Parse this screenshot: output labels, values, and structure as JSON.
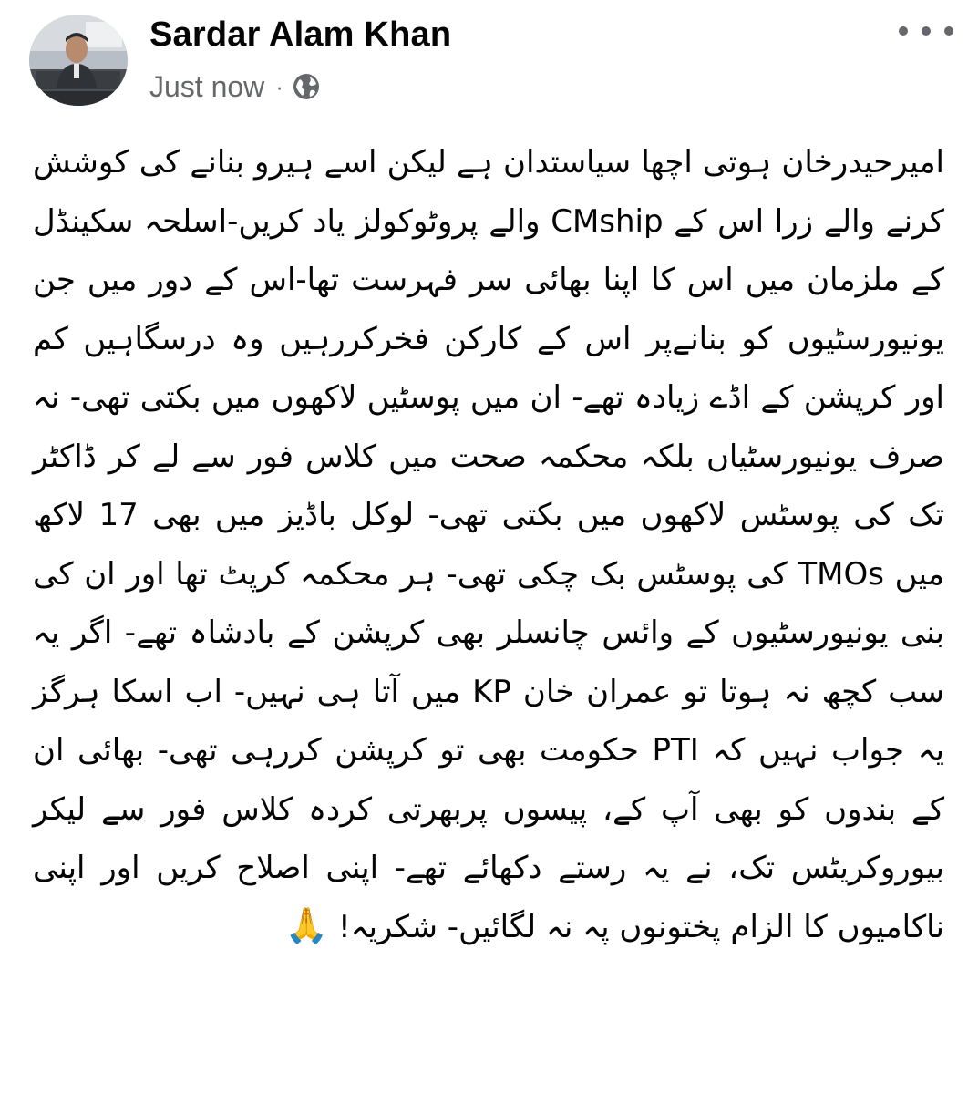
{
  "post": {
    "author": "Sardar Alam Khan",
    "timestamp": "Just now",
    "separator": "·",
    "privacy_icon": "globe-icon",
    "more_icon": "more-options-icon",
    "avatar_icon": "profile-avatar"
  },
  "content": {
    "text": "امیرحیدرخان ہوتی اچھا سیاستدان ہے لیکن اسے ہیرو بنانے کی کوشش کرنے والے زرا اس کے CMship والے پروٹوکولز یاد کریں-اسلحہ سکینڈل کے ملزمان میں اس کا اپنا بھائی سر فہرست تھا-اس کے دور میں جن یونیورسٹیوں کو بنانےپر اس کے کارکن فخرکررہیں وہ درسگاہیں کم اور کرپشن کے اڈے زیادہ تھے- ان میں پوسٹیں لاکھوں میں بکتی تھی- نہ صرف یونیورسٹیاں بلکہ محکمہ صحت میں کلاس فور سے لے کر ڈاکٹر تک کی پوسٹس لاکھوں میں بکتی تھی- لوکل باڈیز میں بھی 17 لاکھ میں TMOs کی پوسٹس بک چکی تھی- ہر محکمہ کرپٹ تھا اور ان کی بنی یونیورسٹیوں کے وائس چانسلر بھی کرپشن کے بادشاہ تھے- اگر یہ سب کچھ نہ ہوتا تو عمران خان KP میں آتا ہی نہیں- اب اسکا ہرگز یہ جواب نہیں کہ PTI حکومت بھی تو کرپشن کررہی تھی- بھائی ان کے بندوں کو بھی آپ کے، پیسوں پربھرتی کردہ کلاس فور سے لیکر بیوروکریٹس تک، نے یہ رستے دکھائے تھے- اپنی اصلاح کریں اور اپنی ناکامیوں کا الزام پختونوں پہ نہ لگائیں- شکریہ!",
    "emoji": "🙏",
    "emoji_icon": "folded-hands-icon"
  },
  "colors": {
    "text": "#050505",
    "secondary": "#65676b",
    "background": "#ffffff"
  }
}
